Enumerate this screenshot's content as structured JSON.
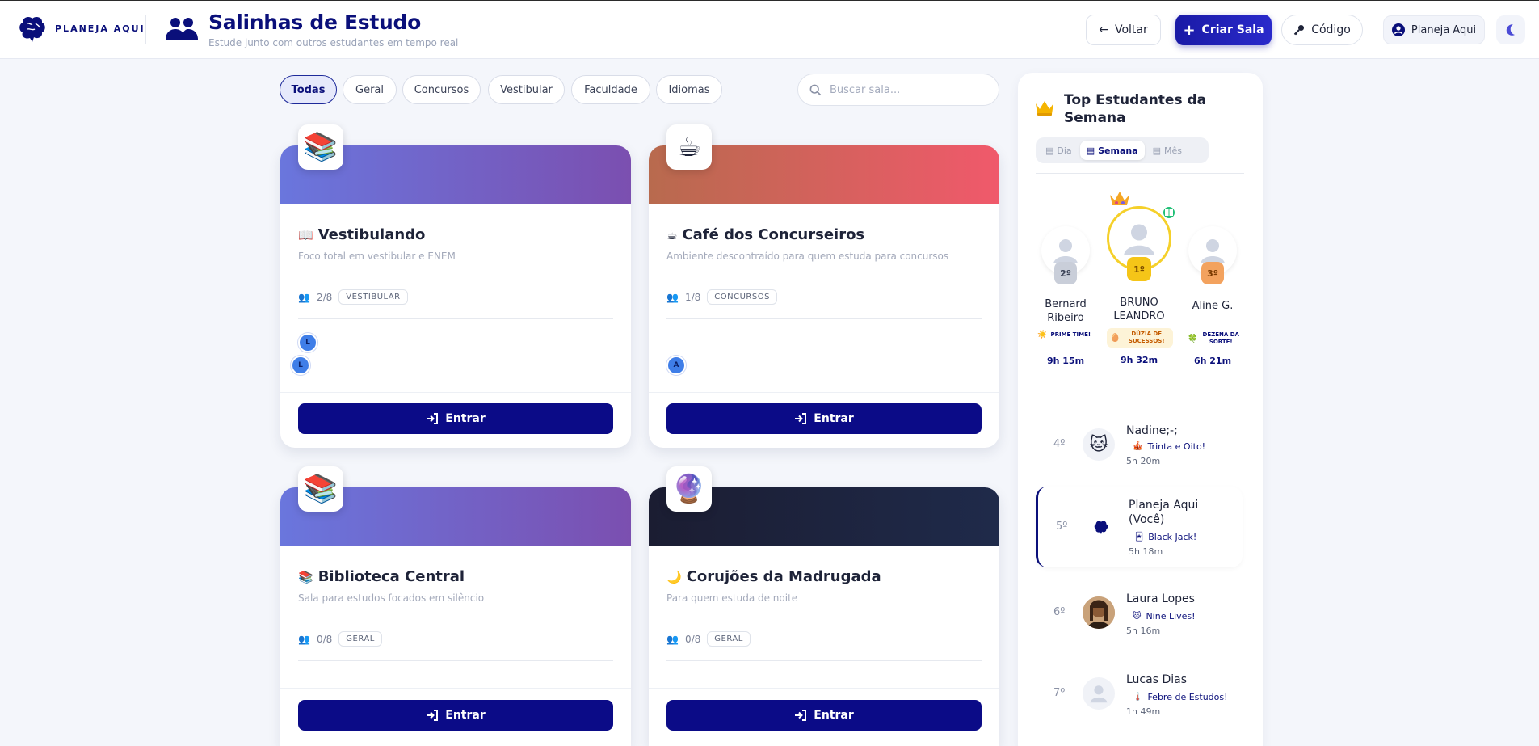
{
  "brand": {
    "name": "PLANEJA AQUI"
  },
  "header": {
    "title": "Salinhas de Estudo",
    "subtitle": "Estude junto com outros estudantes em tempo real",
    "back_label": "Voltar",
    "create_label": "Criar Sala",
    "code_label": "Código",
    "user_label": "Planeja Aqui"
  },
  "filters": {
    "chips": [
      "Todas",
      "Geral",
      "Concursos",
      "Vestibular",
      "Faculdade",
      "Idiomas"
    ],
    "active": "Todas",
    "search_placeholder": "Buscar sala..."
  },
  "rooms": [
    {
      "emoji": "📚",
      "title_emoji": "📖",
      "title": "Vestibulando",
      "description": "Foco total em vestibular e ENEM",
      "occupancy": "2/8",
      "category": "VESTIBULAR",
      "members": [
        "L",
        "L"
      ],
      "enter_label": "Entrar"
    },
    {
      "emoji": "☕",
      "title_emoji": "☕",
      "title": "Café dos Concurseiros",
      "description": "Ambiente descontraído para quem estuda para concursos",
      "occupancy": "1/8",
      "category": "CONCURSOS",
      "members": [
        "A"
      ],
      "enter_label": "Entrar"
    },
    {
      "emoji": "📚",
      "title_emoji": "📚",
      "title": "Biblioteca Central",
      "description": "Sala para estudos focados em silêncio",
      "occupancy": "0/8",
      "category": "GERAL",
      "members": [],
      "enter_label": "Entrar"
    },
    {
      "emoji": "🔮",
      "title_emoji": "🌙",
      "title": "Corujões da Madrugada",
      "description": "Para quem estuda de noite",
      "occupancy": "0/8",
      "category": "GERAL",
      "members": [],
      "enter_label": "Entrar"
    }
  ],
  "leaderboard": {
    "title": "Top Estudantes da Semana",
    "periods": [
      "Dia",
      "Semana",
      "Mês"
    ],
    "active_period": "Semana",
    "podium": [
      {
        "rank": "2º",
        "name": "Bernard Ribeiro",
        "achievement_icon": "☀️",
        "achievement": "PRIME TIME!",
        "time": "9h 15m"
      },
      {
        "rank": "1º",
        "name": "BRUNO LEANDRO",
        "achievement_icon": "🥚",
        "achievement": "DÚZIA DE SUCESSOS!",
        "time": "9h 32m"
      },
      {
        "rank": "3º",
        "name": "Aline G.",
        "achievement_icon": "🍀",
        "achievement": "DEZENA DA SORTE!",
        "time": "6h 21m"
      }
    ],
    "list": [
      {
        "rank": "4º",
        "name": "Nadine;-;",
        "achievement_icon": "🎪",
        "achievement": "Trinta e Oito!",
        "time": "5h 20m",
        "avatar": "🐱",
        "me": false
      },
      {
        "rank": "5º",
        "name": "Planeja Aqui (Você)",
        "achievement_icon": "🃏",
        "achievement": "Black Jack!",
        "time": "5h 18m",
        "avatar": "logo",
        "me": true
      },
      {
        "rank": "6º",
        "name": "Laura Lopes",
        "achievement_icon": "🐱",
        "achievement": "Nine Lives!",
        "time": "5h 16m",
        "avatar": "photo",
        "me": false
      },
      {
        "rank": "7º",
        "name": "Lucas Dias",
        "achievement_icon": "🌡️",
        "achievement": "Febre de Estudos!",
        "time": "1h 49m",
        "avatar": "default",
        "me": false
      }
    ]
  },
  "colors": {
    "primary": "#0b0b87",
    "accent": "#2a2acb",
    "gold": "#f5c518",
    "silver": "#c9ced9",
    "bronze": "#f3a25e"
  }
}
